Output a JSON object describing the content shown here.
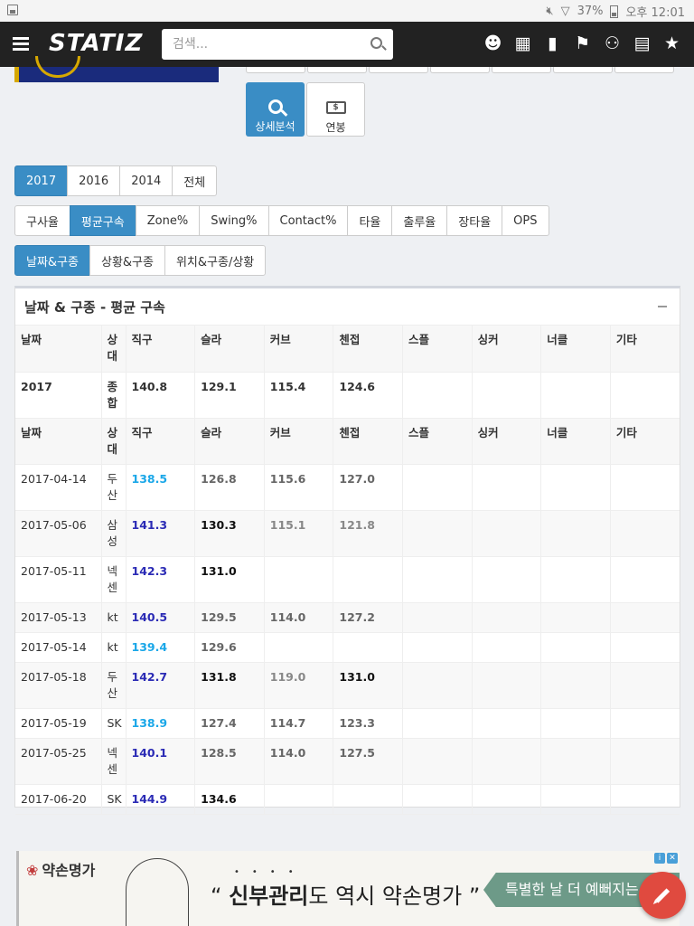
{
  "status_bar": {
    "battery": "37%",
    "time": "오후 12:01"
  },
  "navbar": {
    "logo": "STATIZ",
    "search_placeholder": "검색...",
    "icons": [
      "users-icon",
      "table-icon",
      "bookmark-icon",
      "flag-icon",
      "person-icon",
      "calendar-icon",
      "star-icon"
    ]
  },
  "action_buttons": {
    "analysis": "상세분석",
    "salary": "연봉"
  },
  "year_tabs": [
    "2017",
    "2016",
    "2014",
    "전체"
  ],
  "stat_tabs": [
    "구사율",
    "평균구속",
    "Zone%",
    "Swing%",
    "Contact%",
    "타율",
    "출루율",
    "장타율",
    "OPS"
  ],
  "split_tabs": [
    "날짜&구종",
    "상황&구종",
    "위치&구종/상황"
  ],
  "panel": {
    "title": "날짜 & 구종 - 평균 구속",
    "columns": [
      "날짜",
      "상대",
      "직구",
      "슬라",
      "커브",
      "첸접",
      "스플",
      "싱커",
      "너클",
      "기타"
    ],
    "total_row": {
      "date": "2017",
      "opp": "종합",
      "values": [
        "140.8",
        "129.1",
        "115.4",
        "124.6",
        "",
        "",
        "",
        ""
      ]
    },
    "rows": [
      {
        "date": "2017-04-14",
        "opp": "두산",
        "values": [
          "138.5",
          "126.8",
          "115.6",
          "127.0",
          "",
          "",
          "",
          ""
        ]
      },
      {
        "date": "2017-05-06",
        "opp": "삼성",
        "values": [
          "141.3",
          "130.3",
          "115.1",
          "121.8",
          "",
          "",
          "",
          ""
        ]
      },
      {
        "date": "2017-05-11",
        "opp": "넥센",
        "values": [
          "142.3",
          "131.0",
          "",
          "",
          "",
          "",
          "",
          ""
        ]
      },
      {
        "date": "2017-05-13",
        "opp": "kt",
        "values": [
          "140.5",
          "129.5",
          "114.0",
          "127.2",
          "",
          "",
          "",
          ""
        ]
      },
      {
        "date": "2017-05-14",
        "opp": "kt",
        "values": [
          "139.4",
          "129.6",
          "",
          "",
          "",
          "",
          "",
          ""
        ]
      },
      {
        "date": "2017-05-18",
        "opp": "두산",
        "values": [
          "142.7",
          "131.8",
          "119.0",
          "131.0",
          "",
          "",
          "",
          ""
        ]
      },
      {
        "date": "2017-05-19",
        "opp": "SK",
        "values": [
          "138.9",
          "127.4",
          "114.7",
          "123.3",
          "",
          "",
          "",
          ""
        ]
      },
      {
        "date": "2017-05-25",
        "opp": "넥센",
        "values": [
          "140.1",
          "128.5",
          "114.0",
          "127.5",
          "",
          "",
          "",
          ""
        ]
      },
      {
        "date": "2017-06-20",
        "opp": "SK",
        "values": [
          "144.9",
          "134.6",
          "",
          "",
          "",
          "",
          "",
          ""
        ]
      }
    ]
  },
  "ad": {
    "brand": "약손명가",
    "headline_bold": "신부관리",
    "headline_rest": "도 역시 약손명가",
    "green_text": "특별한 날 더 예뻐지는 날"
  },
  "colors": {
    "accent": "#3a8dc5",
    "navbar": "#222222",
    "fab": "#e04a3f"
  }
}
